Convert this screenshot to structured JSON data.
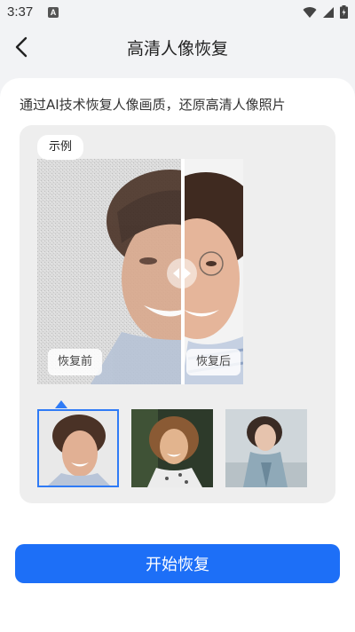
{
  "status_bar": {
    "time": "3:37",
    "notification_letter": "A"
  },
  "header": {
    "title": "高清人像恢复"
  },
  "intro": {
    "text": "通过AI技术恢复人像画质，还原高清人像照片"
  },
  "demo": {
    "tag": "示例",
    "before_label": "恢复前",
    "after_label": "恢复后"
  },
  "thumbnails": [
    {
      "name": "portrait-1",
      "selected": true
    },
    {
      "name": "portrait-2",
      "selected": false
    },
    {
      "name": "portrait-3",
      "selected": false
    }
  ],
  "action": {
    "start_label": "开始恢复"
  },
  "colors": {
    "accent": "#1d6ff7",
    "selected_border": "#2f7bf6",
    "panel_bg": "#eeeeee"
  }
}
